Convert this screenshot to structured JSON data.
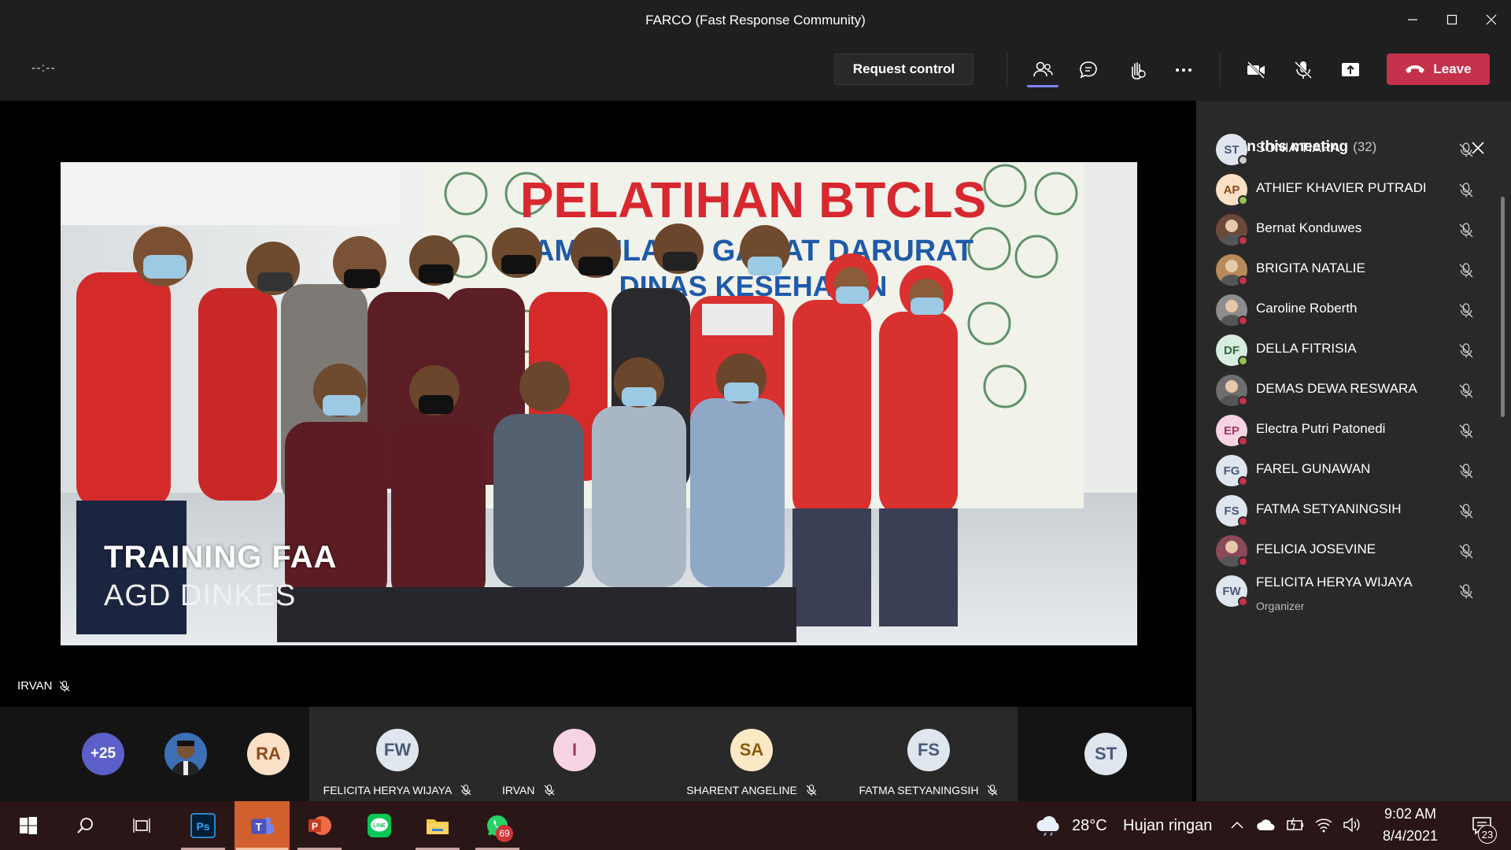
{
  "window": {
    "title": "FARCO (Fast Response Community)"
  },
  "toolbar": {
    "timer": "--:--",
    "request_control_label": "Request control",
    "leave_label": "Leave"
  },
  "stage": {
    "overlay_title": "TRAINING FAA",
    "overlay_subtitle": "AGD DINKES",
    "banner_title": "PELATIHAN BTCLS",
    "banner_line2": "AMBULANS GAWAT DARURAT",
    "banner_line3": "DINAS KESEHATAN",
    "speaker_name": "IRVAN"
  },
  "gallery": {
    "overflow_label": "+25",
    "tiles": [
      {
        "initials": "RA",
        "name": ""
      },
      {
        "initials": "FW",
        "name": "FELICITA HERYA WIJAYA"
      },
      {
        "initials": "I",
        "name": "IRVAN"
      },
      {
        "initials": "SA",
        "name": "SHARENT ANGELINE"
      },
      {
        "initials": "FS",
        "name": "FATMA SETYANINGSIH"
      },
      {
        "initials": "ST",
        "name": ""
      }
    ]
  },
  "panel": {
    "title": "In this meeting",
    "count": "(32)",
    "participants": [
      {
        "initials": "ST",
        "name": "SONIA TIARA",
        "status": "away"
      },
      {
        "initials": "AP",
        "name": "ATHIEF KHAVIER PUTRADI",
        "status": "available"
      },
      {
        "initials": "",
        "name": "Bernat Konduwes",
        "status": "busy"
      },
      {
        "initials": "",
        "name": "BRIGITA NATALIE",
        "status": "busy"
      },
      {
        "initials": "",
        "name": "Caroline Roberth",
        "status": "busy"
      },
      {
        "initials": "DF",
        "name": "DELLA FITRISIA",
        "status": "available"
      },
      {
        "initials": "",
        "name": "DEMAS DEWA RESWARA",
        "status": "busy"
      },
      {
        "initials": "EP",
        "name": "Electra Putri Patonedi",
        "status": "busy"
      },
      {
        "initials": "FG",
        "name": "FAREL GUNAWAN",
        "status": "busy"
      },
      {
        "initials": "FS",
        "name": "FATMA SETYANINGSIH",
        "status": "busy"
      },
      {
        "initials": "",
        "name": "FELICIA JOSEVINE",
        "status": "busy"
      },
      {
        "initials": "FW",
        "name": "FELICITA HERYA WIJAYA",
        "role": "Organizer",
        "status": "busy"
      }
    ]
  },
  "taskbar": {
    "temperature": "28°C",
    "weather": "Hujan ringan",
    "time": "9:02 AM",
    "date": "8/4/2021",
    "whatsapp_badge": "69",
    "notification_count": "23"
  },
  "colors": {
    "leave": "#c4314b",
    "accent": "#7f85f5",
    "status_available": "#92c353",
    "status_busy": "#c4314b",
    "status_away": "#cccccc"
  }
}
